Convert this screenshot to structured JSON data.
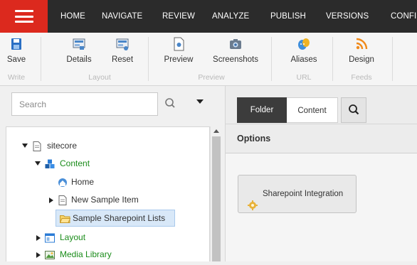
{
  "topnav": {
    "tabs": [
      "HOME",
      "NAVIGATE",
      "REVIEW",
      "ANALYZE",
      "PUBLISH",
      "VERSIONS",
      "CONFI"
    ]
  },
  "ribbon": {
    "buttons": {
      "save": "Save",
      "details": "Details",
      "reset": "Reset",
      "preview": "Preview",
      "screenshots": "Screenshots",
      "aliases": "Aliases",
      "design": "Design"
    },
    "groups": {
      "write": "Write",
      "layout": "Layout",
      "preview": "Preview",
      "url": "URL",
      "feeds": "Feeds"
    }
  },
  "search": {
    "placeholder": "Search"
  },
  "tree": {
    "sitecore": "sitecore",
    "content": "Content",
    "home": "Home",
    "new_sample_item": "New Sample Item",
    "sample_sharepoint_lists": "Sample Sharepoint Lists",
    "layout": "Layout",
    "media_library": "Media Library"
  },
  "editor": {
    "tabs": {
      "folder": "Folder",
      "content": "Content"
    },
    "section_title": "Options",
    "option_button": "Sharepoint Integration"
  },
  "colors": {
    "topnav_bg": "#2b2b2b",
    "brand_red": "#dc291e",
    "accent_blue": "#2a7bd6",
    "tree_green": "#1a8c1a",
    "selection": "#d8e8f8"
  }
}
